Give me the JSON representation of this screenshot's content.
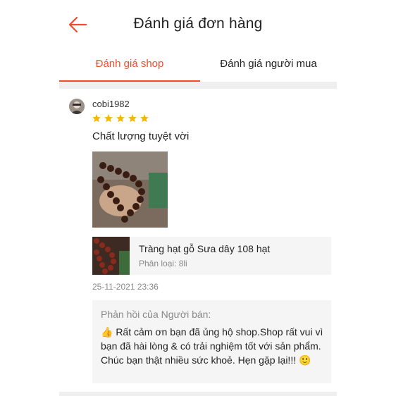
{
  "header": {
    "title": "Đánh giá đơn hàng",
    "back_icon": "arrow-left-icon",
    "accent": "#ee4d2d"
  },
  "tabs": [
    {
      "label": "Đánh giá shop",
      "active": true
    },
    {
      "label": "Đánh giá người mua",
      "active": false
    }
  ],
  "review": {
    "username": "cobi1982",
    "rating": 5,
    "text": "Chất lượng tuyệt vời",
    "product": {
      "name": "Tràng hạt gỗ Sưa dây 108 hạt",
      "variant": "Phân loại: 8li"
    },
    "date": "25-11-2021 23:36"
  },
  "seller_reply": {
    "title": "Phản hồi của Người bán:",
    "body": "👍 Rất cảm ơn bạn đã ủng hộ shop.Shop rất vui vì bạn đã hài lòng & có trải nghiệm tốt với sản phẩm. Chúc bạn thật nhiều sức khoẻ. Hẹn gặp lại!!! 🙂"
  },
  "colors": {
    "accent": "#ee4d2d",
    "star": "#f5b700"
  }
}
